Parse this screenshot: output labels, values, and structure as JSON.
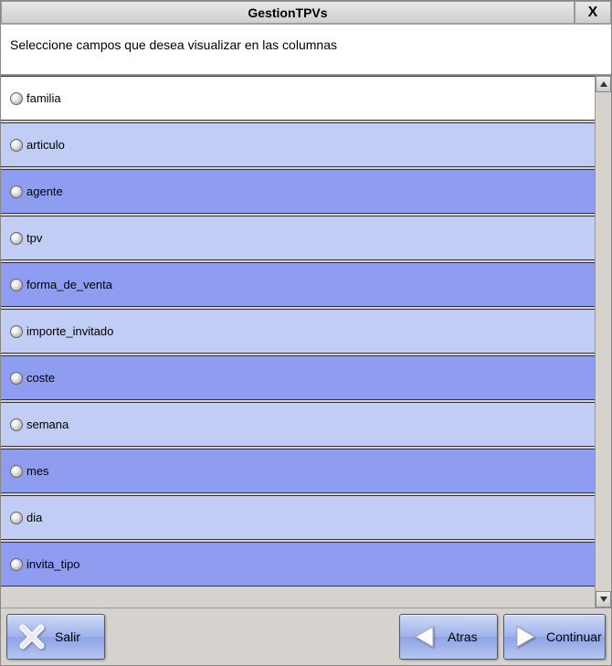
{
  "window": {
    "title": "GestionTPVs",
    "close_label": "X"
  },
  "instructions": "Seleccione campos que desea visualizar en las columnas",
  "fields": [
    {
      "label": "familia",
      "shade": "white"
    },
    {
      "label": "articulo",
      "shade": "light"
    },
    {
      "label": "agente",
      "shade": "dark"
    },
    {
      "label": "tpv",
      "shade": "light"
    },
    {
      "label": "forma_de_venta",
      "shade": "dark"
    },
    {
      "label": "importe_invitado",
      "shade": "light"
    },
    {
      "label": "coste",
      "shade": "dark"
    },
    {
      "label": "semana",
      "shade": "light"
    },
    {
      "label": "mes",
      "shade": "dark"
    },
    {
      "label": "dia",
      "shade": "light"
    },
    {
      "label": "invita_tipo",
      "shade": "dark"
    }
  ],
  "buttons": {
    "salir": "Salir",
    "atras": "Atras",
    "continuar": "Continuar"
  }
}
